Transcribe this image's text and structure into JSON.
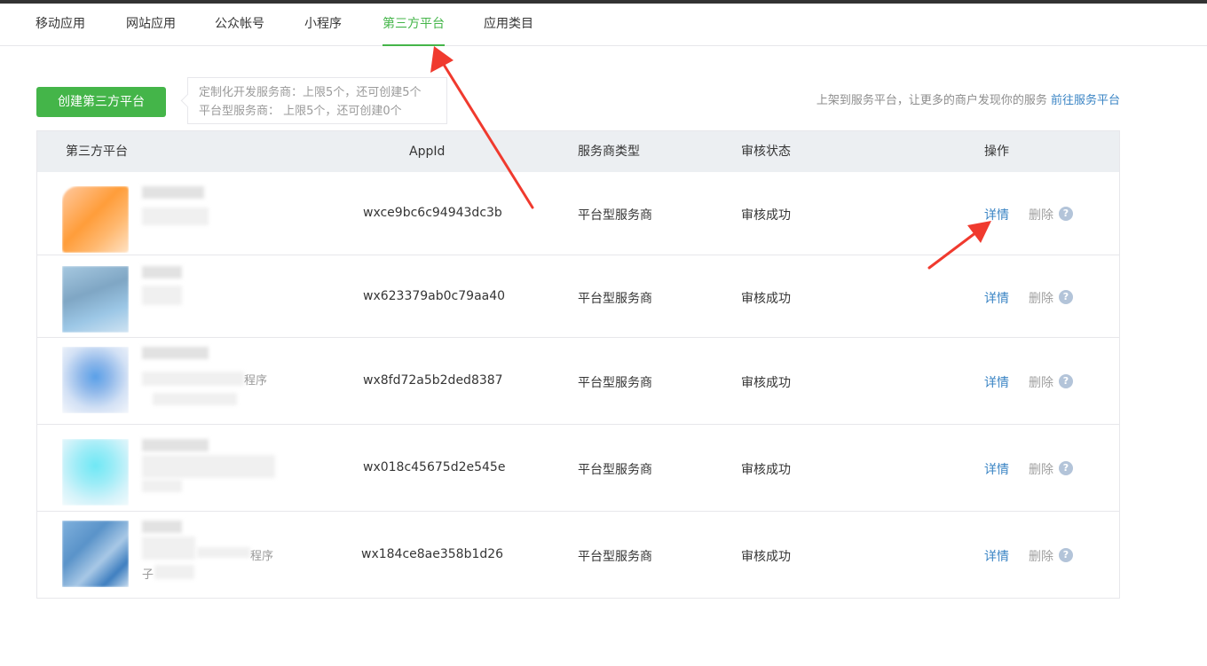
{
  "tabs": [
    {
      "label": "移动应用",
      "active": false
    },
    {
      "label": "网站应用",
      "active": false
    },
    {
      "label": "公众帐号",
      "active": false
    },
    {
      "label": "小程序",
      "active": false
    },
    {
      "label": "第三方平台",
      "active": true
    },
    {
      "label": "应用类目",
      "active": false
    }
  ],
  "create_button": "创建第三方平台",
  "quota": {
    "line1": "定制化开发服务商：上限5个，还可创建5个",
    "line2": "平台型服务商： 上限5个，还可创建0个"
  },
  "promo": {
    "text": "上架到服务平台，让更多的商户发现你的服务 ",
    "link": "前往服务平台"
  },
  "table": {
    "headers": [
      "第三方平台",
      "AppId",
      "服务商类型",
      "审核状态",
      "操作"
    ],
    "rows": [
      {
        "platform_suffix": "",
        "platform_suffix2": "",
        "appid": "wxce9bc6c94943dc3b",
        "type": "平台型服务商",
        "status": "审核成功",
        "detail": "详情",
        "delete": "删除"
      },
      {
        "platform_suffix": "",
        "platform_suffix2": "",
        "appid": "wx623379ab0c79aa40",
        "type": "平台型服务商",
        "status": "审核成功",
        "detail": "详情",
        "delete": "删除"
      },
      {
        "platform_suffix": "程序",
        "platform_suffix2": "",
        "appid": "wx8fd72a5b2ded8387",
        "type": "平台型服务商",
        "status": "审核成功",
        "detail": "详情",
        "delete": "删除"
      },
      {
        "platform_suffix": "",
        "platform_suffix2": "",
        "appid": "wx018c45675d2e545e",
        "type": "平台型服务商",
        "status": "审核成功",
        "detail": "详情",
        "delete": "删除"
      },
      {
        "platform_suffix": "程序",
        "platform_suffix2": "子",
        "appid": "wx184ce8ae358b1d26",
        "type": "平台型服务商",
        "status": "审核成功",
        "detail": "详情",
        "delete": "删除"
      }
    ]
  },
  "help_glyph": "?",
  "colors": {
    "accent_green": "#44b549",
    "link_blue": "#3a84c4",
    "header_bg": "#eceff2",
    "annotation_red": "#f03a2e"
  },
  "icons": {
    "help": "question-circle-icon",
    "annotation": "red-arrow-icon"
  }
}
